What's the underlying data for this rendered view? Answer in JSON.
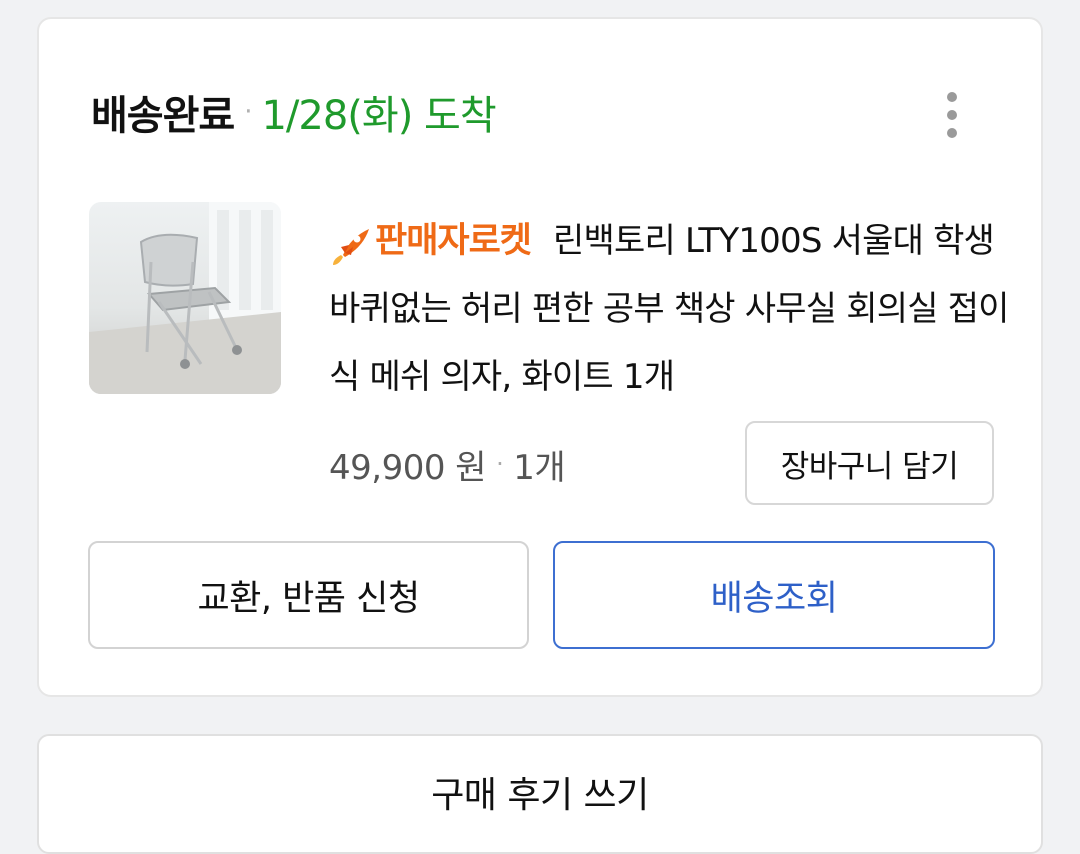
{
  "order": {
    "status_title": "배송완료",
    "status_separator": "·",
    "status_date": "1/28(화) 도착",
    "colors": {
      "status_date": "#1f9a2c",
      "rocket": "#ef6a16",
      "tracking": "#2e60c8"
    }
  },
  "product": {
    "badge_label": "판매자로켓",
    "badge_icon": "rocket-icon",
    "name": "린백토리 LTY100S 서울대 학생 바퀴없는 허리 편한 공부 책상 사무실 회의실 접이식 메쉬 의자, 화이트 1개",
    "image": "chair-thumbnail",
    "price": "49,900 원",
    "price_separator": "·",
    "quantity": "1개"
  },
  "buttons": {
    "add_to_cart": "장바구니 담기",
    "exchange_return": "교환, 반품 신청",
    "delivery_tracking": "배송조회",
    "write_review": "구매 후기 쓰기"
  },
  "icons": {
    "more": "more-vertical-icon"
  }
}
